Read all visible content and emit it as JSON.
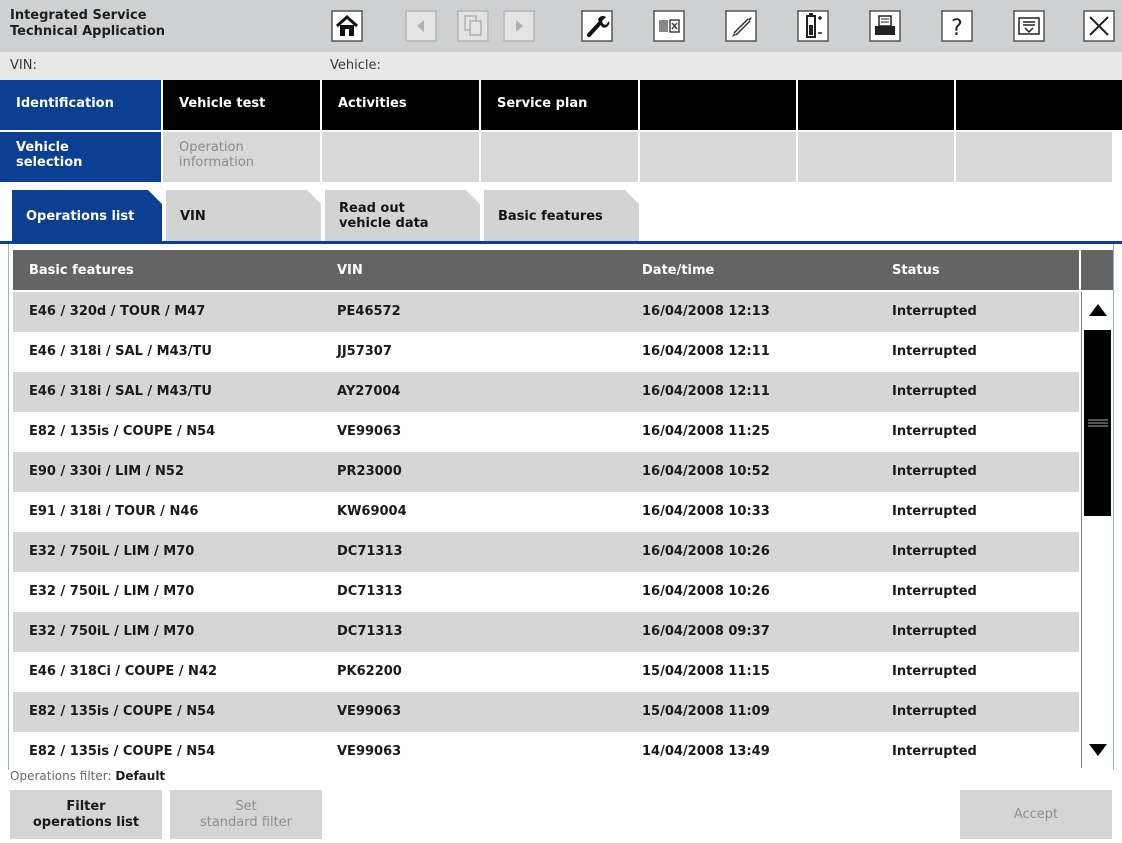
{
  "app": {
    "title": "Integrated Service\nTechnical Application"
  },
  "toolbar": [
    {
      "name": "home-button",
      "icon": "home-icon",
      "enabled": true
    },
    {
      "name": "back-button",
      "icon": "arrow-left-icon",
      "enabled": false
    },
    {
      "name": "documents-button",
      "icon": "documents-icon",
      "enabled": false
    },
    {
      "name": "forward-button",
      "icon": "arrow-right-icon",
      "enabled": false
    },
    {
      "name": "workshop-button",
      "icon": "wrench-icon",
      "enabled": true
    },
    {
      "name": "split-view-button",
      "icon": "split-view-icon",
      "enabled": true
    },
    {
      "name": "measurement-button",
      "icon": "multimeter-icon",
      "enabled": true
    },
    {
      "name": "battery-button",
      "icon": "battery-icon",
      "enabled": true
    },
    {
      "name": "print-button",
      "icon": "printer-icon",
      "enabled": true
    },
    {
      "name": "help-button",
      "icon": "question-icon",
      "enabled": true
    },
    {
      "name": "minimize-button",
      "icon": "minimize-icon",
      "enabled": true
    },
    {
      "name": "close-button",
      "icon": "close-icon",
      "enabled": true
    }
  ],
  "info": {
    "vin_label": "VIN:",
    "vehicle_label": "Vehicle:"
  },
  "main_tabs": [
    {
      "label": "Identification",
      "active": true
    },
    {
      "label": "Vehicle test",
      "active": false
    },
    {
      "label": "Activities",
      "active": false
    },
    {
      "label": "Service plan",
      "active": false
    },
    {
      "label": "",
      "active": false
    },
    {
      "label": "",
      "active": false
    },
    {
      "label": "",
      "active": false
    }
  ],
  "sub_tabs": [
    {
      "label": "Vehicle\nselection",
      "active": true
    },
    {
      "label": "Operation\ninformation",
      "active": false
    },
    {
      "label": "",
      "active": false
    },
    {
      "label": "",
      "active": false
    },
    {
      "label": "",
      "active": false
    },
    {
      "label": "",
      "active": false
    },
    {
      "label": "",
      "active": false
    }
  ],
  "folder_tabs": [
    {
      "label": "Operations list",
      "active": true
    },
    {
      "label": "VIN",
      "active": false
    },
    {
      "label": "Read out\nvehicle data",
      "active": false
    },
    {
      "label": "Basic features",
      "active": false
    }
  ],
  "table": {
    "columns": [
      "Basic features",
      "VIN",
      "Date/time",
      "Status"
    ],
    "rows": [
      [
        "E46 / 320d / TOUR / M47",
        "PE46572",
        "16/04/2008 12:13",
        "Interrupted"
      ],
      [
        "E46 / 318i / SAL / M43/TU",
        "JJ57307",
        "16/04/2008 12:11",
        "Interrupted"
      ],
      [
        "E46 / 318i / SAL / M43/TU",
        "AY27004",
        "16/04/2008 12:11",
        "Interrupted"
      ],
      [
        "E82 / 135is / COUPE / N54",
        "VE99063",
        "16/04/2008 11:25",
        "Interrupted"
      ],
      [
        "E90 / 330i / LIM / N52",
        "PR23000",
        "16/04/2008 10:52",
        "Interrupted"
      ],
      [
        "E91 / 318i / TOUR / N46",
        "KW69004",
        "16/04/2008 10:33",
        "Interrupted"
      ],
      [
        "E32 / 750iL / LIM / M70",
        "DC71313",
        "16/04/2008 10:26",
        "Interrupted"
      ],
      [
        "E32 / 750iL / LIM / M70",
        "DC71313",
        "16/04/2008 10:26",
        "Interrupted"
      ],
      [
        "E32 / 750iL / LIM / M70",
        "DC71313",
        "16/04/2008 09:37",
        "Interrupted"
      ],
      [
        "E46 / 318Ci / COUPE / N42",
        "PK62200",
        "15/04/2008 11:15",
        "Interrupted"
      ],
      [
        "E82 / 135is / COUPE / N54",
        "VE99063",
        "15/04/2008 11:09",
        "Interrupted"
      ],
      [
        "E82 / 135is / COUPE / N54",
        "VE99063",
        "14/04/2008 13:49",
        "Interrupted"
      ]
    ]
  },
  "filter": {
    "label": "Operations filter:",
    "value": "Default"
  },
  "buttons": {
    "filter_list": "Filter\noperations list",
    "set_standard": "Set\nstandard filter",
    "accept": "Accept"
  },
  "colors": {
    "accent": "#0b3f91",
    "tab_black": "#000000",
    "header_gray": "#646464",
    "row_alt": "#d6d6d6"
  }
}
